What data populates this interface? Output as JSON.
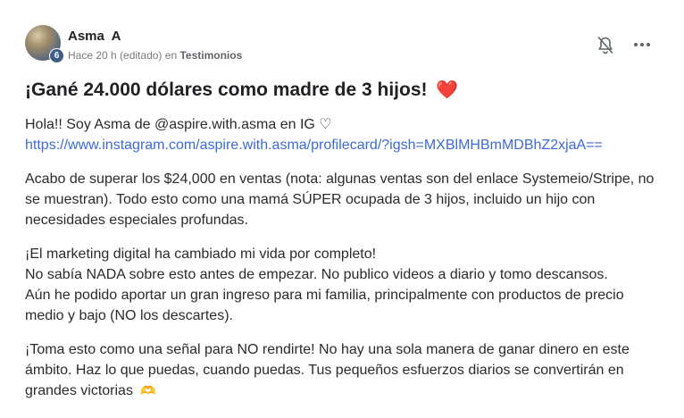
{
  "post": {
    "author": "Asma  A",
    "level": "6",
    "time": "Hace 20 h",
    "edited": "(editado)",
    "in_word": "en",
    "category": "Testimonios",
    "title": "¡Gané 24.000 dólares como madre de 3 hijos!",
    "title_emoji": "❤️",
    "paragraphs": {
      "p1_line1": "Hola!! Soy Asma de @aspire.with.asma en IG ♡",
      "p1_link": "https://www.instagram.com/aspire.with.asma/profilecard/?igsh=MXBlMHBmMDBhZ2xjaA==",
      "p2": "Acabo de superar los $24,000 en ventas (nota: algunas ventas son del enlace Systemeio/Stripe, no se muestran). Todo esto como una mamá SÚPER ocupada de 3 hijos, incluido un hijo con necesidades especiales profundas.",
      "p3_line1": "¡El marketing digital ha cambiado mi vida por completo!",
      "p3_line2": "No sabía NADA sobre esto antes de empezar. No publico videos a diario y tomo descansos.",
      "p3_line3": "Aún he podido aportar un gran ingreso para mi familia, principalmente con productos de precio medio y bajo (NO los descartes).",
      "p4": "¡Toma esto como una señal para NO rendirte! No hay una sola manera de ganar dinero en este ámbito. Haz lo que puedas, cuando puedas. Tus pequeños esfuerzos diarios se convertirán en grandes victorias",
      "p4_emoji": "🫶"
    }
  },
  "icons": {
    "bell": "bell-off-icon",
    "more": "more-horizontal-icon"
  },
  "colors": {
    "link": "#3b6bd6",
    "badge": "#3f5d86",
    "heart": "#e0245e"
  }
}
